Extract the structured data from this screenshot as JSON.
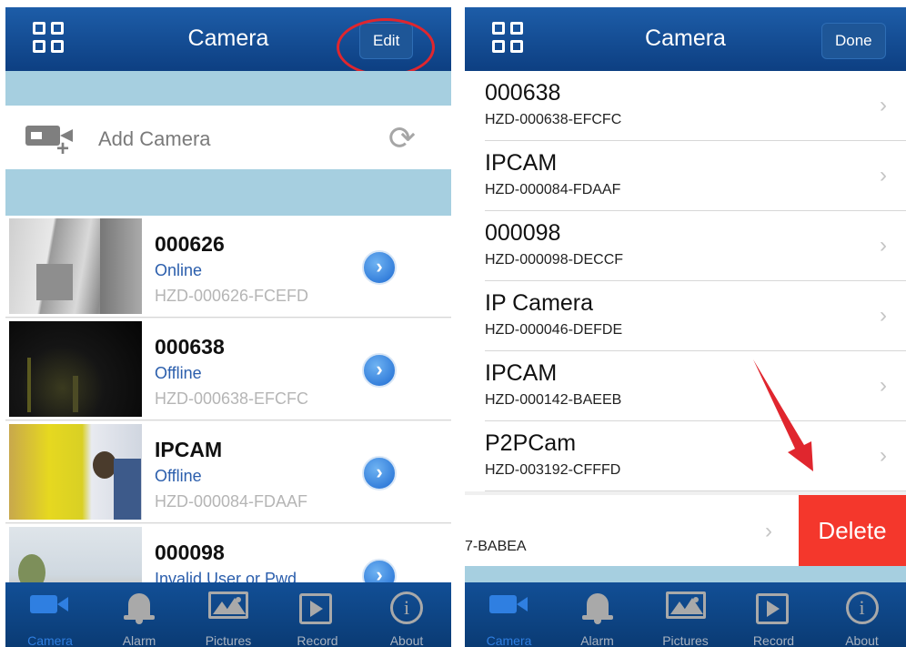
{
  "left": {
    "nav": {
      "title": "Camera",
      "edit_label": "Edit"
    },
    "add_camera": {
      "label": "Add Camera"
    },
    "cameras": [
      {
        "name": "000626",
        "status": "Online",
        "id": "HZD-000626-FCEFD"
      },
      {
        "name": "000638",
        "status": "Offline",
        "id": "HZD-000638-EFCFC"
      },
      {
        "name": "IPCAM",
        "status": "Offline",
        "id": "HZD-000084-FDAAF"
      },
      {
        "name": "000098",
        "status": "Invalid User or Pwd",
        "id": ""
      }
    ],
    "tabs": [
      {
        "label": "Camera",
        "icon": "camera-icon",
        "active": true
      },
      {
        "label": "Alarm",
        "icon": "bell-icon"
      },
      {
        "label": "Pictures",
        "icon": "pictures-icon"
      },
      {
        "label": "Record",
        "icon": "record-icon"
      },
      {
        "label": "About",
        "icon": "info-icon"
      }
    ]
  },
  "right": {
    "nav": {
      "title": "Camera",
      "done_label": "Done"
    },
    "cameras": [
      {
        "name": "000638",
        "id": "HZD-000638-EFCFC"
      },
      {
        "name": "IPCAM",
        "id": "HZD-000084-FDAAF"
      },
      {
        "name": "000098",
        "id": "HZD-000098-DECCF"
      },
      {
        "name": "IP Camera",
        "id": "HZD-000046-DEFDE"
      },
      {
        "name": "IPCAM",
        "id": "HZD-000142-BAEEB"
      },
      {
        "name": "P2PCam",
        "id": "HZD-003192-CFFFD"
      }
    ],
    "swiped_item": {
      "id_fragment": "7-BABEA",
      "delete_label": "Delete"
    },
    "tabs": [
      {
        "label": "Camera",
        "active": true
      },
      {
        "label": "Alarm"
      },
      {
        "label": "Pictures"
      },
      {
        "label": "Record"
      },
      {
        "label": "About"
      }
    ]
  },
  "colors": {
    "navbar": "#0d3f82",
    "accent": "#2f7fe1",
    "status_text": "#2b5eac",
    "delete": "#f4372c",
    "band": "#a6cfe0",
    "annotation": "#e0262e"
  }
}
